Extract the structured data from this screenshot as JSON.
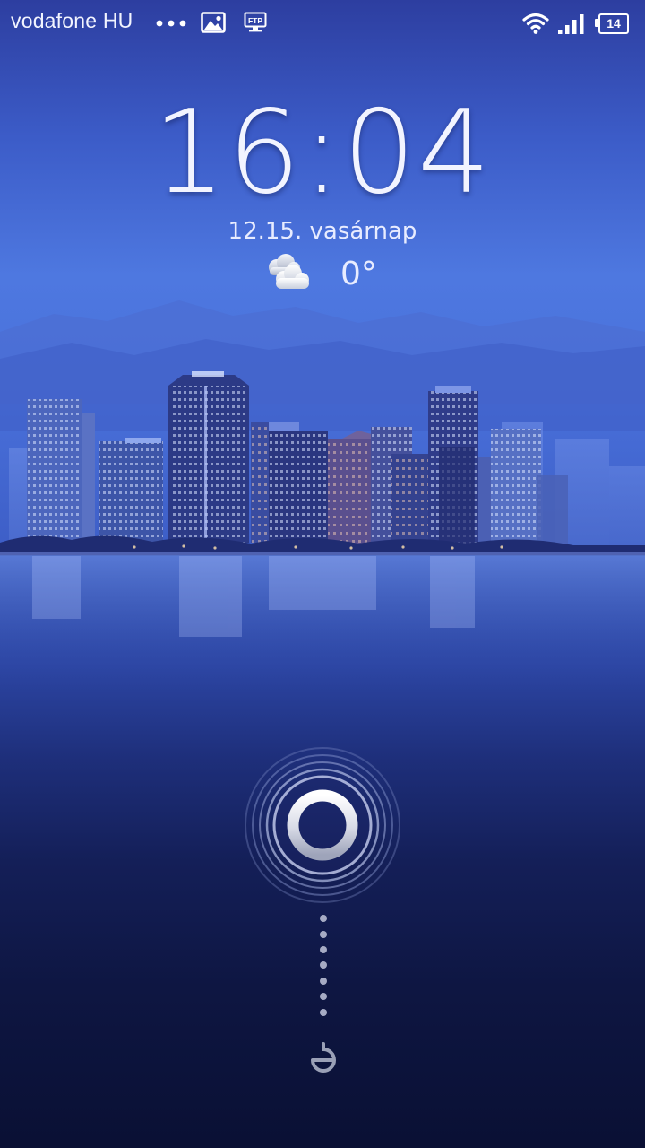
{
  "status_bar": {
    "carrier": "vodafone HU",
    "notification_icons": [
      "more-dots-icon",
      "gallery-icon",
      "ftp-icon"
    ],
    "ftp_label": "FTP",
    "system_icons": [
      "wifi-icon",
      "signal-icon",
      "battery-icon"
    ],
    "battery_level": "14"
  },
  "lockscreen": {
    "time": "16:04",
    "date": "12.15. vasárnap",
    "weather": {
      "icon": "cloudy-icon",
      "temperature": "0°"
    },
    "unlock_icon": "unlock-ring-icon",
    "target_icon": "target-icon"
  },
  "colors": {
    "sky_top": "#2d3ea0",
    "sky_mid": "#4e78e0",
    "water_bottom": "#0a1034",
    "text": "#f2f4ff"
  }
}
